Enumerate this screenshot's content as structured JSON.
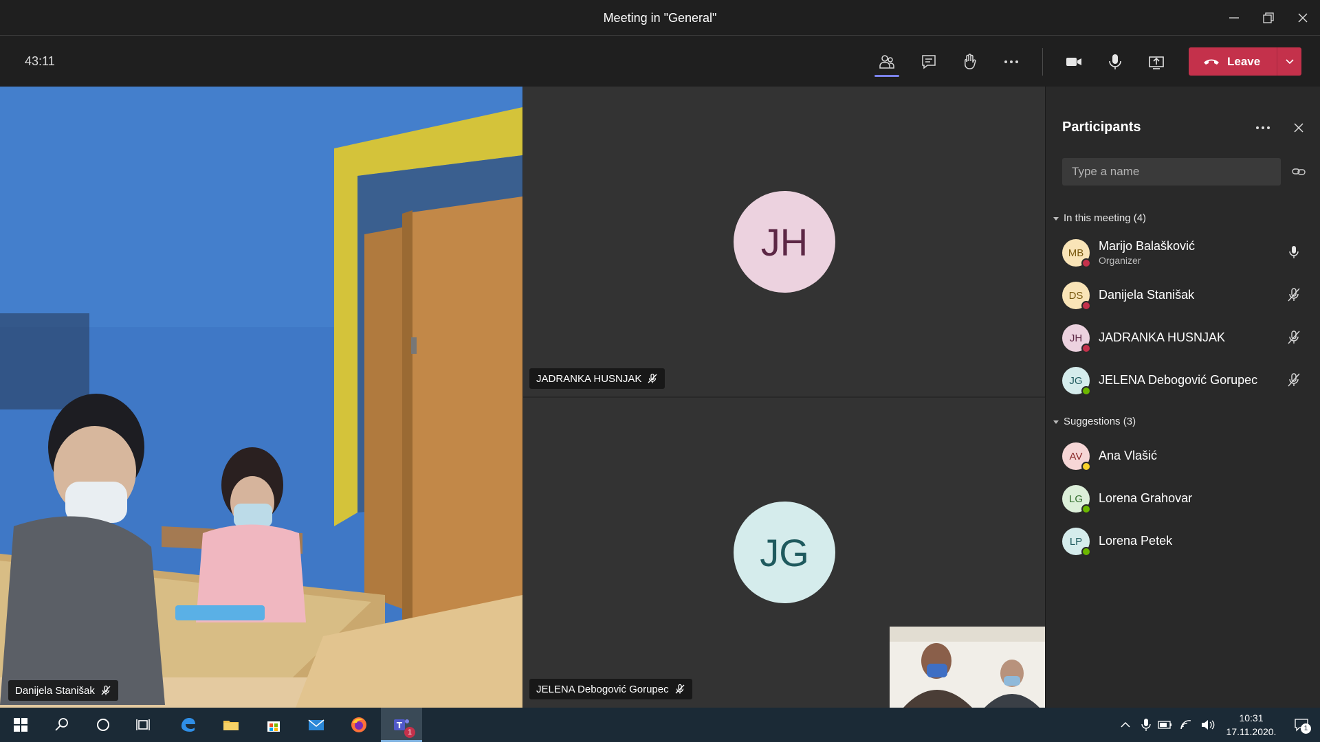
{
  "window": {
    "title": "Meeting in \"General\""
  },
  "toolbar": {
    "timer": "43:11",
    "leave_label": "Leave"
  },
  "stage": {
    "tiles": [
      {
        "name": "JADRANKA HUSNJAK",
        "initials": "JH",
        "avatar_bg": "#ecd2df",
        "avatar_fg": "#5c2745"
      },
      {
        "name": "JELENA Debogović Gorupec",
        "initials": "JG",
        "avatar_bg": "#d5ecec",
        "avatar_fg": "#1f5a5e"
      }
    ],
    "video_name": "Danijela Stanišak"
  },
  "panel": {
    "title": "Participants",
    "search_placeholder": "Type a name",
    "in_meeting_label": "In this meeting (4)",
    "suggestions_label": "Suggestions (3)",
    "in_meeting": [
      {
        "initials": "MB",
        "name": "Marijo Balašković",
        "role": "Organizer",
        "avatar_bg": "#f9e4b7",
        "avatar_fg": "#7a5a10",
        "status": "#c4314b",
        "mic": "mic-icon"
      },
      {
        "initials": "DS",
        "name": "Danijela Stanišak",
        "avatar_bg": "#f9e4b7",
        "avatar_fg": "#7a5a10",
        "status": "#c4314b",
        "mic": "mic-muted-icon"
      },
      {
        "initials": "JH",
        "name": "JADRANKA HUSNJAK",
        "avatar_bg": "#ecd2df",
        "avatar_fg": "#5c2745",
        "status": "#c4314b",
        "mic": "mic-muted-icon"
      },
      {
        "initials": "JG",
        "name": "JELENA Debogović Gorupec",
        "avatar_bg": "#d5ecec",
        "avatar_fg": "#1f5a5e",
        "status": "#6bb700",
        "mic": "mic-muted-icon"
      }
    ],
    "suggestions": [
      {
        "initials": "AV",
        "name": "Ana Vlašić",
        "avatar_bg": "#f6d6d6",
        "avatar_fg": "#8a2a2a",
        "status": "#f8d22a"
      },
      {
        "initials": "LG",
        "name": "Lorena Grahovar",
        "avatar_bg": "#dcefd9",
        "avatar_fg": "#2f6b2a",
        "status": "#6bb700"
      },
      {
        "initials": "LP",
        "name": "Lorena Petek",
        "avatar_bg": "#d5ecec",
        "avatar_fg": "#1f5a5e",
        "status": "#6bb700"
      }
    ]
  },
  "taskbar": {
    "time": "10:31",
    "date": "17.11.2020.",
    "teams_badge": "1",
    "notification_badge": "1"
  },
  "colors": {
    "accent": "#7b83eb",
    "leave": "#c4314b",
    "taskbar": "#1b2a36"
  }
}
